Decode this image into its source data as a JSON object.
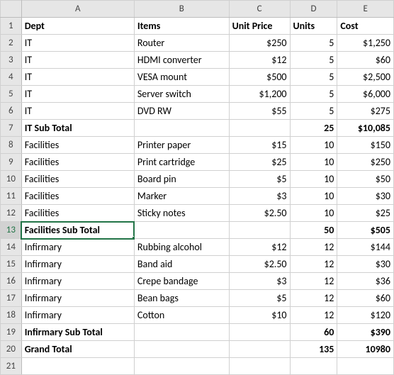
{
  "columns": [
    "A",
    "B",
    "C",
    "D",
    "E"
  ],
  "chart_data": {
    "type": "table",
    "headers": [
      "Dept",
      "Items",
      "Unit Price",
      "Units",
      "Cost"
    ],
    "rows": [
      {
        "num": "1",
        "bold": true,
        "align": [
          "left",
          "left",
          "left",
          "left",
          "left"
        ],
        "cells": [
          "Dept",
          "Items",
          "Unit Price",
          "Units",
          "Cost"
        ]
      },
      {
        "num": "2",
        "bold": false,
        "align": [
          "left",
          "left",
          "right",
          "right",
          "right"
        ],
        "cells": [
          "IT",
          "Router",
          "$250",
          "5",
          "$1,250"
        ]
      },
      {
        "num": "3",
        "bold": false,
        "align": [
          "left",
          "left",
          "right",
          "right",
          "right"
        ],
        "cells": [
          "IT",
          "HDMI converter",
          "$12",
          "5",
          "$60"
        ]
      },
      {
        "num": "4",
        "bold": false,
        "align": [
          "left",
          "left",
          "right",
          "right",
          "right"
        ],
        "cells": [
          "IT",
          "VESA mount",
          "$500",
          "5",
          "$2,500"
        ]
      },
      {
        "num": "5",
        "bold": false,
        "align": [
          "left",
          "left",
          "right",
          "right",
          "right"
        ],
        "cells": [
          "IT",
          "Server switch",
          "$1,200",
          "5",
          "$6,000"
        ]
      },
      {
        "num": "6",
        "bold": false,
        "align": [
          "left",
          "left",
          "right",
          "right",
          "right"
        ],
        "cells": [
          "IT",
          "DVD RW",
          "$55",
          "5",
          "$275"
        ]
      },
      {
        "num": "7",
        "bold": true,
        "align": [
          "left",
          "left",
          "right",
          "right",
          "right"
        ],
        "cells": [
          "IT Sub Total",
          "",
          "",
          "25",
          "$10,085"
        ]
      },
      {
        "num": "8",
        "bold": false,
        "align": [
          "left",
          "left",
          "right",
          "right",
          "right"
        ],
        "cells": [
          "Facilities",
          "Printer paper",
          "$15",
          "10",
          "$150"
        ]
      },
      {
        "num": "9",
        "bold": false,
        "align": [
          "left",
          "left",
          "right",
          "right",
          "right"
        ],
        "cells": [
          "Facilities",
          "Print cartridge",
          "$25",
          "10",
          "$250"
        ]
      },
      {
        "num": "10",
        "bold": false,
        "align": [
          "left",
          "left",
          "right",
          "right",
          "right"
        ],
        "cells": [
          "Facilities",
          "Board pin",
          "$5",
          "10",
          "$50"
        ]
      },
      {
        "num": "11",
        "bold": false,
        "align": [
          "left",
          "left",
          "right",
          "right",
          "right"
        ],
        "cells": [
          "Facilities",
          "Marker",
          "$3",
          "10",
          "$30"
        ]
      },
      {
        "num": "12",
        "bold": false,
        "align": [
          "left",
          "left",
          "right",
          "right",
          "right"
        ],
        "cells": [
          "Facilities",
          "Sticky notes",
          "$2.50",
          "10",
          "$25"
        ]
      },
      {
        "num": "13",
        "bold": true,
        "align": [
          "left",
          "left",
          "right",
          "right",
          "right"
        ],
        "selected": true,
        "cells": [
          "Facilities Sub Total",
          "",
          "",
          "50",
          "$505"
        ]
      },
      {
        "num": "14",
        "bold": false,
        "align": [
          "left",
          "left",
          "right",
          "right",
          "right"
        ],
        "cells": [
          "Infirmary",
          "Rubbing alcohol",
          "$12",
          "12",
          "$144"
        ]
      },
      {
        "num": "15",
        "bold": false,
        "align": [
          "left",
          "left",
          "right",
          "right",
          "right"
        ],
        "cells": [
          "Infirmary",
          "Band aid",
          "$2.50",
          "12",
          "$30"
        ]
      },
      {
        "num": "16",
        "bold": false,
        "align": [
          "left",
          "left",
          "right",
          "right",
          "right"
        ],
        "cells": [
          "Infirmary",
          "Crepe bandage",
          "$3",
          "12",
          "$36"
        ]
      },
      {
        "num": "17",
        "bold": false,
        "align": [
          "left",
          "left",
          "right",
          "right",
          "right"
        ],
        "cells": [
          "Infirmary",
          "Bean bags",
          "$5",
          "12",
          "$60"
        ]
      },
      {
        "num": "18",
        "bold": false,
        "align": [
          "left",
          "left",
          "right",
          "right",
          "right"
        ],
        "cells": [
          "Infirmary",
          "Cotton",
          "$10",
          "12",
          "$120"
        ]
      },
      {
        "num": "19",
        "bold": true,
        "align": [
          "left",
          "left",
          "right",
          "right",
          "right"
        ],
        "cells": [
          "Infirmary Sub Total",
          "",
          "",
          "60",
          "$390"
        ]
      },
      {
        "num": "20",
        "bold": true,
        "align": [
          "left",
          "left",
          "right",
          "right",
          "right"
        ],
        "cells": [
          "Grand Total",
          "",
          "",
          "135",
          "10980"
        ]
      },
      {
        "num": "21",
        "bold": false,
        "align": [
          "left",
          "left",
          "left",
          "left",
          "left"
        ],
        "cells": [
          "",
          "",
          "",
          "",
          ""
        ]
      }
    ]
  }
}
